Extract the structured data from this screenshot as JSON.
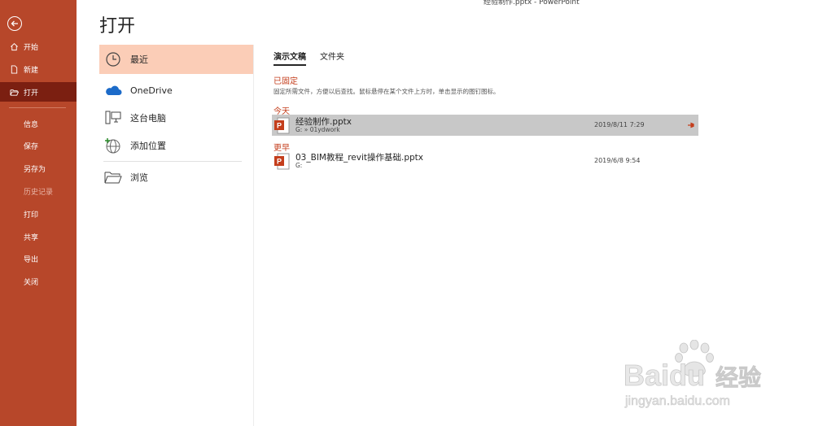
{
  "window": {
    "title": "经验制作.pptx  -  PowerPoint"
  },
  "sidebar": {
    "items": [
      {
        "label": "开始",
        "icon": "home-icon"
      },
      {
        "label": "新建",
        "icon": "new-file-icon"
      },
      {
        "label": "打开",
        "icon": "open-folder-icon"
      },
      {
        "label": "信息"
      },
      {
        "label": "保存"
      },
      {
        "label": "另存为"
      },
      {
        "label": "历史记录"
      },
      {
        "label": "打印"
      },
      {
        "label": "共享"
      },
      {
        "label": "导出"
      },
      {
        "label": "关闭"
      }
    ]
  },
  "page": {
    "title": "打开"
  },
  "locations": {
    "items": [
      {
        "label": "最近",
        "icon": "clock-icon"
      },
      {
        "label": "OneDrive",
        "icon": "onedrive-cloud-icon"
      },
      {
        "label": "这台电脑",
        "icon": "computer-icon"
      },
      {
        "label": "添加位置",
        "icon": "add-location-globe-icon"
      },
      {
        "label": "浏览",
        "icon": "browse-folder-icon"
      }
    ]
  },
  "tabs": [
    {
      "label": "演示文稿"
    },
    {
      "label": "文件夹"
    }
  ],
  "pinned": {
    "heading": "已固定",
    "description": "固定所需文件，方便以后查找。鼠标悬停在某个文件上方时，单击显示的图钉图标。"
  },
  "today": {
    "heading": "今天",
    "files": [
      {
        "name": "经验制作.pptx",
        "path": "G: » 01ydwork",
        "date": "2019/8/11 7:29"
      }
    ]
  },
  "earlier": {
    "heading": "更早",
    "files": [
      {
        "name": "03_BIM教程_revit操作基础.pptx",
        "path": "G:",
        "date": "2019/6/8 9:54"
      }
    ]
  },
  "watermark": {
    "brand": "Baidu",
    "brand_cn": "经验",
    "url": "jingyan.baidu.com"
  },
  "colors": {
    "accent": "#b7472a",
    "active_nav": "#7b1f11",
    "active_location": "#fbcdb7",
    "section_head": "#c43e1c",
    "selected_row": "#c8c8c8"
  }
}
